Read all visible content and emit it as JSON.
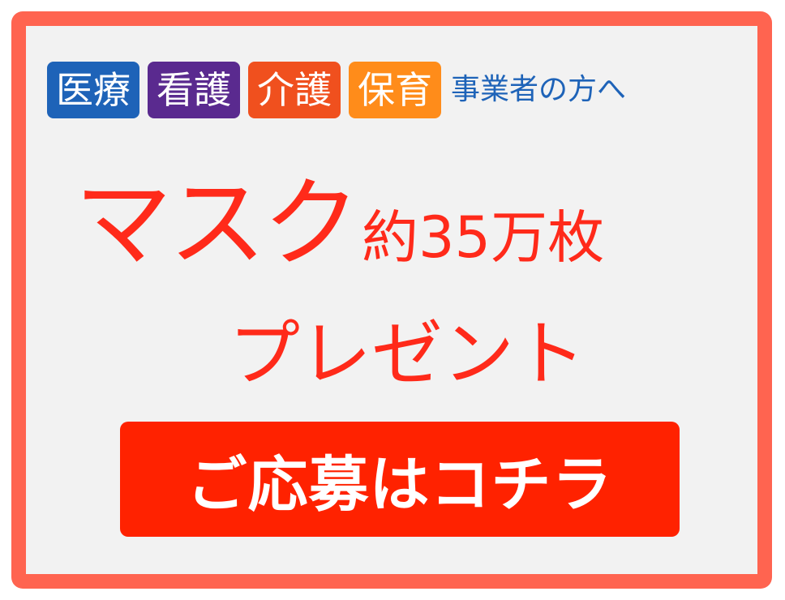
{
  "tags": {
    "items": [
      "医療",
      "看護",
      "介護",
      "保育"
    ],
    "colors": [
      "#1e63b8",
      "#5a2a8f",
      "#f0501e",
      "#ff8c1a"
    ]
  },
  "audience": "事業者の方へ",
  "headline": {
    "main": "マスク",
    "sub": "約35万枚"
  },
  "subline": "プレゼント",
  "cta": {
    "label": "ご応募はコチラ",
    "color": "#ff2200"
  },
  "theme": {
    "border_color": "#ff6450",
    "text_red": "#ff2a1a",
    "background": "#f2f2f2"
  }
}
